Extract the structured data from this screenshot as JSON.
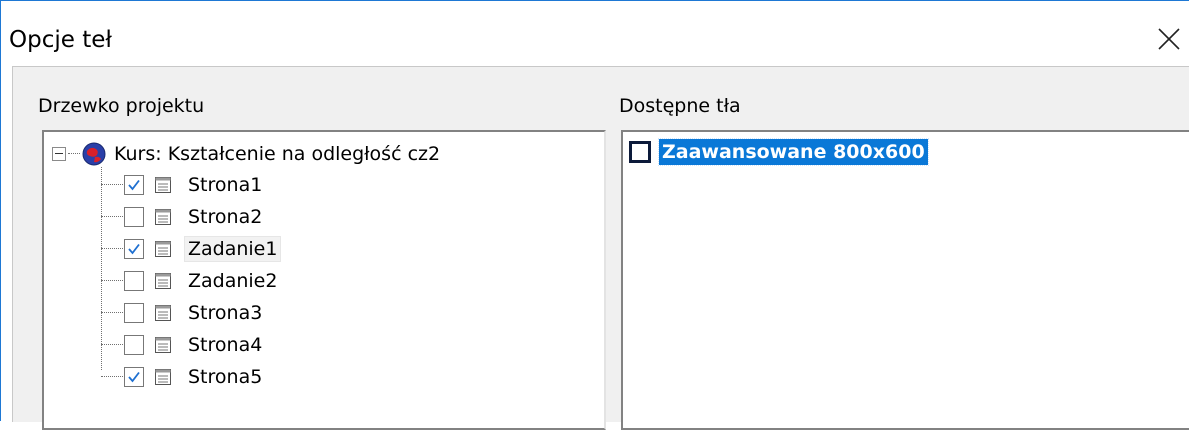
{
  "window": {
    "title": "Opcje teł",
    "close_icon": "close-icon"
  },
  "project_tree": {
    "label": "Drzewko projektu",
    "root": {
      "label": "Kurs: Kształcenie na odległość cz2",
      "icon": "course-globe-icon",
      "expanded": true
    },
    "items": [
      {
        "label": "Strona1",
        "checked": true
      },
      {
        "label": "Strona2",
        "checked": false
      },
      {
        "label": "Zadanie1",
        "checked": true,
        "hovered": true
      },
      {
        "label": "Zadanie2",
        "checked": false
      },
      {
        "label": "Strona3",
        "checked": false
      },
      {
        "label": "Strona4",
        "checked": false
      },
      {
        "label": "Strona5",
        "checked": true
      }
    ]
  },
  "available_backgrounds": {
    "label": "Dostępne tła",
    "items": [
      {
        "label": "Zaawansowane 800x600",
        "checked": false,
        "selected": true
      }
    ]
  },
  "colors": {
    "accent_border": "#1e78d4",
    "selection": "#0a78d7",
    "check": "#1e6fd0"
  }
}
